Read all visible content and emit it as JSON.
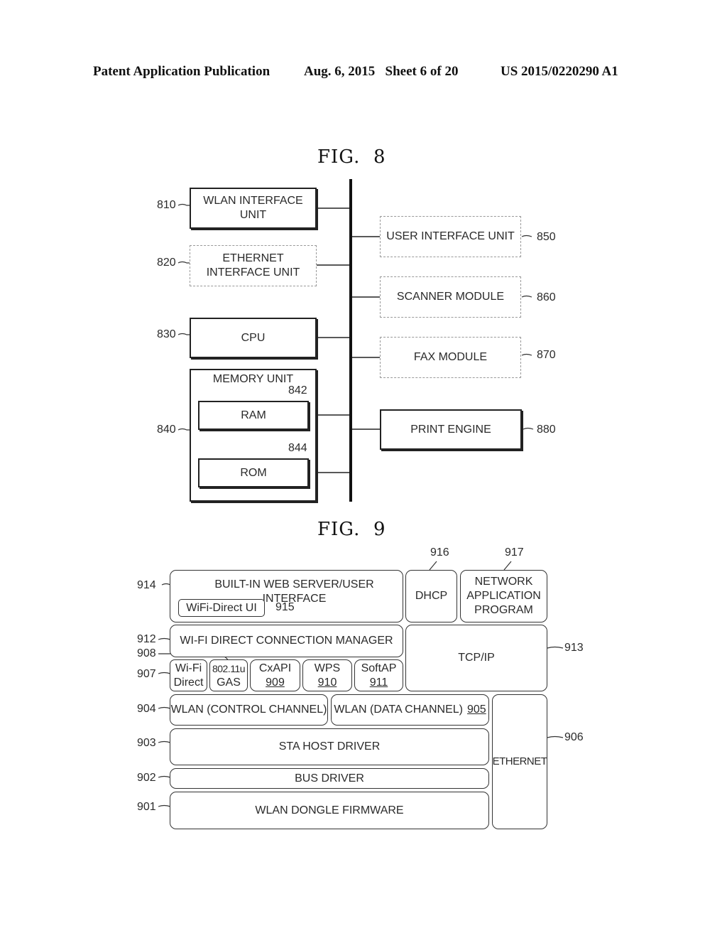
{
  "header": {
    "publication": "Patent Application Publication",
    "date_sheet": "Aug. 6, 2015   Sheet 6 of 20",
    "number": "US 2015/0220290 A1"
  },
  "fig8": {
    "title": "FIG.  8",
    "blocks": {
      "wlan_interface": {
        "ref": "810",
        "label": "WLAN INTERFACE\nUNIT",
        "line1": "WLAN INTERFACE",
        "line2": "UNIT",
        "style": "solid"
      },
      "ethernet_interface": {
        "ref": "820",
        "line1": "ETHERNET",
        "line2": "INTERFACE UNIT",
        "style": "dashed"
      },
      "cpu": {
        "ref": "830",
        "label": "CPU",
        "style": "solid"
      },
      "memory_unit": {
        "ref": "840",
        "label": "MEMORY UNIT",
        "style": "solid"
      },
      "ram": {
        "ref": "842",
        "label": "RAM",
        "style": "solid"
      },
      "rom": {
        "ref": "844",
        "label": "ROM",
        "style": "solid"
      },
      "user_interface": {
        "ref": "850",
        "label": "USER INTERFACE UNIT",
        "style": "dashed"
      },
      "scanner": {
        "ref": "860",
        "label": "SCANNER MODULE",
        "style": "dashed"
      },
      "fax": {
        "ref": "870",
        "label": "FAX MODULE",
        "style": "dashed"
      },
      "print_engine": {
        "ref": "880",
        "label": "PRINT ENGINE",
        "style": "solid"
      }
    }
  },
  "fig9": {
    "title": "FIG.  9",
    "blocks": {
      "web_server": {
        "ref": "914",
        "label": "BUILT-IN WEB SERVER/USER INTERFACE"
      },
      "wifi_direct_ui": {
        "ref": "915",
        "label": "WiFi-Direct UI"
      },
      "dhcp": {
        "ref": "916",
        "label": "DHCP"
      },
      "network_app": {
        "ref": "917",
        "line1": "NETWORK",
        "line2": "APPLICATION",
        "line3": "PROGRAM"
      },
      "connection_manager": {
        "ref": "912",
        "label": "WI-FI DIRECT CONNECTION MANAGER"
      },
      "tcpip": {
        "ref": "913",
        "label": "TCP/IP"
      },
      "wifi_direct": {
        "ref": "907",
        "line1": "Wi-Fi",
        "line2": "Direct"
      },
      "gas": {
        "ref": "908",
        "line1": "802.11u",
        "line2": "GAS"
      },
      "cxapi": {
        "ref": "909",
        "line1": "CxAPI",
        "line2": "909"
      },
      "wps": {
        "ref": "910",
        "line1": "WPS",
        "line2": "910"
      },
      "softap": {
        "ref": "911",
        "line1": "SoftAP",
        "line2": "911"
      },
      "wlan_control": {
        "ref": "904",
        "label": "WLAN (CONTROL CHANNEL)"
      },
      "wlan_data": {
        "ref": "905",
        "label": "WLAN (DATA CHANNEL)",
        "num": "905"
      },
      "ethernet": {
        "ref": "906",
        "label": "ETHERNET"
      },
      "sta_host_driver": {
        "ref": "903",
        "label": "STA HOST DRIVER"
      },
      "bus_driver": {
        "ref": "902",
        "label": "BUS DRIVER"
      },
      "dongle_firmware": {
        "ref": "901",
        "label": "WLAN DONGLE FIRMWARE"
      }
    }
  }
}
